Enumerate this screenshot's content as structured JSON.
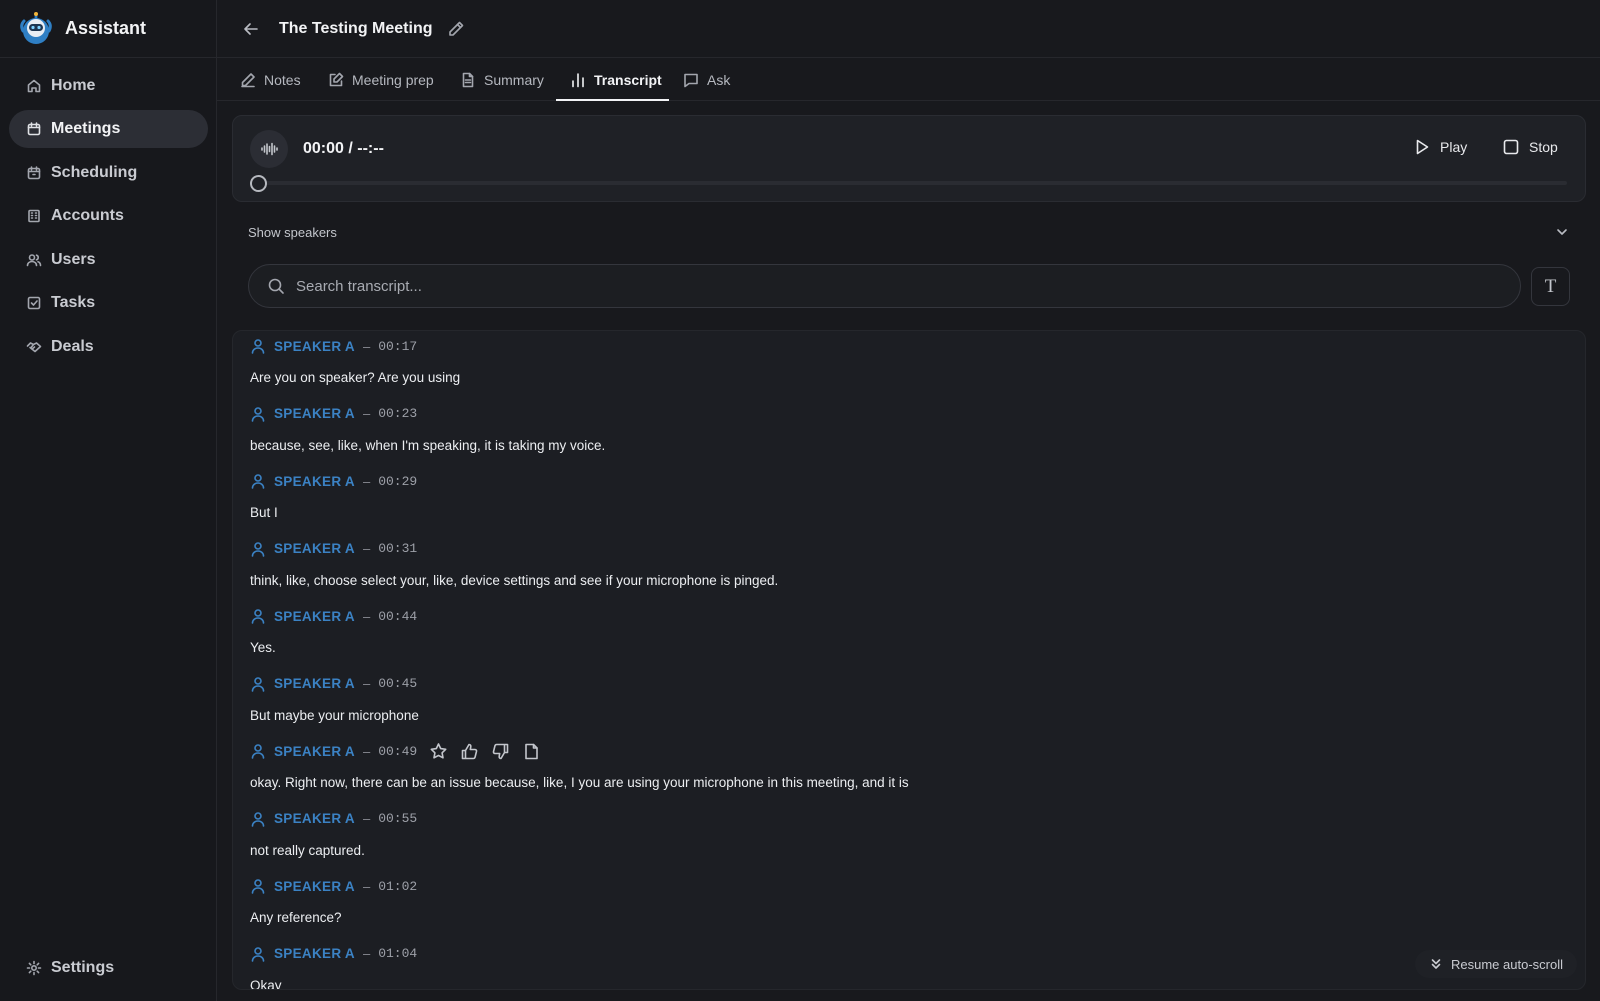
{
  "app": {
    "name": "Assistant"
  },
  "sidebar": {
    "items": [
      {
        "label": "Home",
        "icon": "home-icon"
      },
      {
        "label": "Meetings",
        "icon": "calendar-icon",
        "active": true
      },
      {
        "label": "Scheduling",
        "icon": "calendar-clock-icon"
      },
      {
        "label": "Accounts",
        "icon": "building-icon"
      },
      {
        "label": "Users",
        "icon": "users-icon"
      },
      {
        "label": "Tasks",
        "icon": "checkbox-icon"
      },
      {
        "label": "Deals",
        "icon": "handshake-icon"
      }
    ],
    "settings_label": "Settings"
  },
  "header": {
    "title": "The Testing Meeting"
  },
  "tabs": [
    {
      "label": "Notes",
      "icon": "pencil-icon"
    },
    {
      "label": "Meeting prep",
      "icon": "edit-note-icon"
    },
    {
      "label": "Summary",
      "icon": "document-icon"
    },
    {
      "label": "Transcript",
      "icon": "bar-chart-icon",
      "active": true
    },
    {
      "label": "Ask",
      "icon": "chat-icon"
    }
  ],
  "player": {
    "time": "00:00 / --:--",
    "play_label": "Play",
    "stop_label": "Stop",
    "progress": 0
  },
  "speakers_toggle": {
    "label": "Show speakers"
  },
  "search": {
    "placeholder": "Search transcript..."
  },
  "transcript": [
    {
      "speaker": "SPEAKER A",
      "time": "00:17",
      "text": "Are you on speaker? Are you using"
    },
    {
      "speaker": "SPEAKER A",
      "time": "00:23",
      "text": "because, see, like, when I'm speaking, it is taking my voice."
    },
    {
      "speaker": "SPEAKER A",
      "time": "00:29",
      "text": "But I"
    },
    {
      "speaker": "SPEAKER A",
      "time": "00:31",
      "text": "think, like, choose select your, like, device settings and see if your microphone is pinged."
    },
    {
      "speaker": "SPEAKER A",
      "time": "00:44",
      "text": "Yes."
    },
    {
      "speaker": "SPEAKER A",
      "time": "00:45",
      "text": "But maybe your microphone"
    },
    {
      "speaker": "SPEAKER A",
      "time": "00:49",
      "text": "okay. Right now, there can be an issue because, like, I you are using your microphone in this meeting, and it is",
      "hover_actions": true
    },
    {
      "speaker": "SPEAKER A",
      "time": "00:55",
      "text": "not really captured."
    },
    {
      "speaker": "SPEAKER A",
      "time": "01:02",
      "text": "Any reference?"
    },
    {
      "speaker": "SPEAKER A",
      "time": "01:04",
      "text": "Okay"
    }
  ],
  "resume_label": "Resume auto-scroll"
}
